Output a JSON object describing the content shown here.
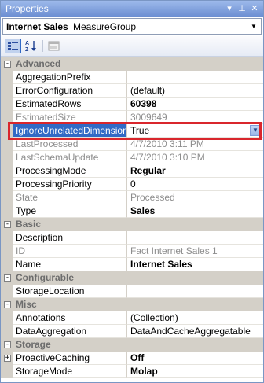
{
  "window": {
    "title": "Properties"
  },
  "titlebar_buttons": {
    "dropdown": "▾",
    "pin": "⊥",
    "close": "✕"
  },
  "selector": {
    "name": "Internet Sales",
    "type": "MeasureGroup"
  },
  "toolbar": {
    "categorized_icon": "categorized-icon",
    "alphabetical_icon": "alphabetical-icon",
    "property_pages_icon": "property-pages-icon"
  },
  "categories": {
    "advanced": "Advanced",
    "basic": "Basic",
    "configurable": "Configurable",
    "misc": "Misc",
    "storage": "Storage"
  },
  "rows": {
    "aggregation_prefix": {
      "name": "AggregationPrefix",
      "value": ""
    },
    "error_configuration": {
      "name": "ErrorConfiguration",
      "value": "(default)"
    },
    "estimated_rows": {
      "name": "EstimatedRows",
      "value": "60398"
    },
    "estimated_size": {
      "name": "EstimatedSize",
      "value": "3009649"
    },
    "ignore_unrelated": {
      "name": "IgnoreUnrelatedDimensions",
      "value": "True"
    },
    "last_processed": {
      "name": "LastProcessed",
      "value": "4/7/2010 3:11 PM"
    },
    "last_schema_update": {
      "name": "LastSchemaUpdate",
      "value": "4/7/2010 3:10 PM"
    },
    "processing_mode": {
      "name": "ProcessingMode",
      "value": "Regular"
    },
    "processing_priority": {
      "name": "ProcessingPriority",
      "value": "0"
    },
    "state": {
      "name": "State",
      "value": "Processed"
    },
    "type": {
      "name": "Type",
      "value": "Sales"
    },
    "description": {
      "name": "Description",
      "value": ""
    },
    "id": {
      "name": "ID",
      "value": "Fact Internet Sales 1"
    },
    "name": {
      "name": "Name",
      "value": "Internet Sales"
    },
    "storage_location": {
      "name": "StorageLocation",
      "value": ""
    },
    "annotations": {
      "name": "Annotations",
      "value": "(Collection)"
    },
    "data_aggregation": {
      "name": "DataAggregation",
      "value": "DataAndCacheAggregatable"
    },
    "proactive_caching": {
      "name": "ProactiveCaching",
      "value": "Off"
    },
    "storage_mode": {
      "name": "StorageMode",
      "value": "Molap"
    }
  },
  "colors": {
    "title_bar": "#7a9ade",
    "selection": "#316ac5",
    "highlight_box": "#d9262c",
    "gutter": "#d4d0c8",
    "readonly_text": "#8d8d8d"
  }
}
